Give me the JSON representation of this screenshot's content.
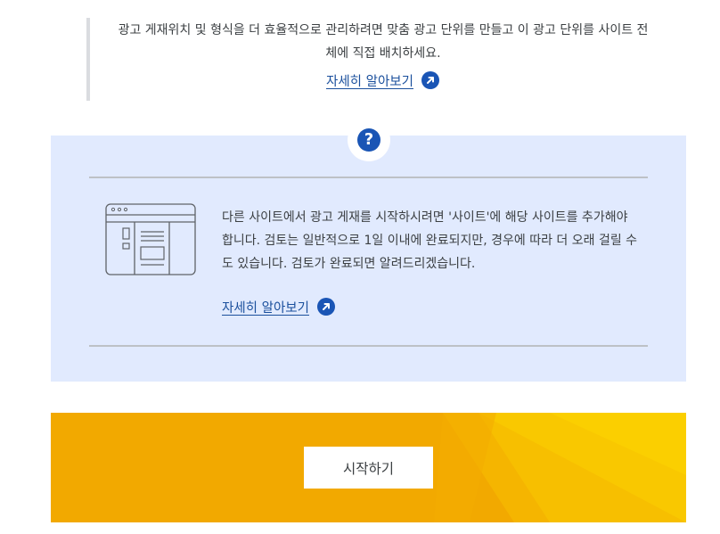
{
  "intro": {
    "text": "광고 게재위치 및 형식을 더 효율적으로 관리하려면 맞춤 광고 단위를 만들고 이 광고 단위를 사이트 전체에 직접 배치하세요.",
    "link_label": "자세히 알아보기"
  },
  "info_panel": {
    "help_icon": "question-mark-icon",
    "text": "다른 사이트에서 광고 게재를 시작하시려면 '사이트'에 해당 사이트를 추가해야 합니다. 검토는 일반적으로 1일 이내에 완료되지만, 경우에 따라 더 오래 걸릴 수도 있습니다. 검토가 완료되면 알려드리겠습니다.",
    "link_label": "자세히 알아보기",
    "illustration": "website-layout-icon"
  },
  "cta": {
    "button_label": "시작하기"
  },
  "colors": {
    "link": "#1a4f9c",
    "accent_blue": "#1a55b5",
    "panel_bg": "#e1eafe",
    "banner_yellow": "#f2a900"
  }
}
